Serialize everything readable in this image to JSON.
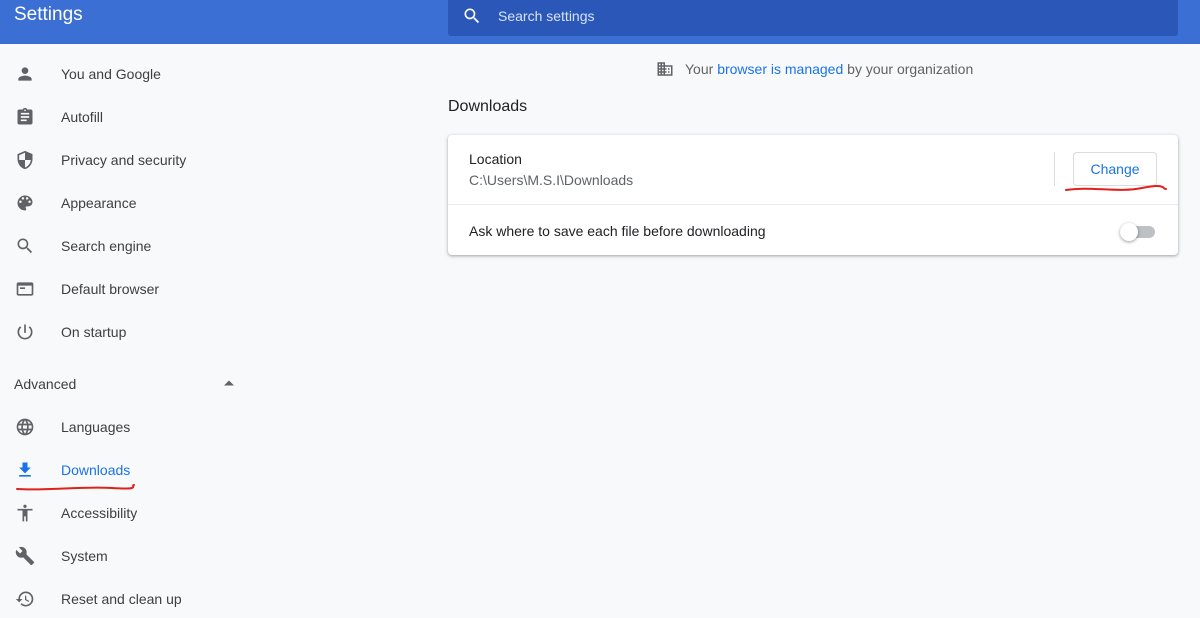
{
  "header": {
    "title": "Settings",
    "search": {
      "placeholder": "Search settings",
      "value": "",
      "icon": "search-icon"
    }
  },
  "sidebar": {
    "items": [
      {
        "label": "You and Google",
        "icon": "person-icon"
      },
      {
        "label": "Autofill",
        "icon": "clipboard-icon"
      },
      {
        "label": "Privacy and security",
        "icon": "shield-icon"
      },
      {
        "label": "Appearance",
        "icon": "palette-icon"
      },
      {
        "label": "Search engine",
        "icon": "search-icon"
      },
      {
        "label": "Default browser",
        "icon": "browser-icon"
      },
      {
        "label": "On startup",
        "icon": "power-icon"
      }
    ],
    "advanced": {
      "label": "Advanced",
      "expanded": true,
      "items": [
        {
          "label": "Languages",
          "icon": "globe-icon"
        },
        {
          "label": "Downloads",
          "icon": "download-icon",
          "active": true
        },
        {
          "label": "Accessibility",
          "icon": "accessibility-icon"
        },
        {
          "label": "System",
          "icon": "wrench-icon"
        },
        {
          "label": "Reset and clean up",
          "icon": "history-icon"
        }
      ]
    }
  },
  "notice": {
    "icon": "building-icon",
    "prefix": "Your ",
    "link1": "browser",
    "middle": " is ",
    "link2": "managed",
    "suffix": " by your organization"
  },
  "downloads": {
    "title": "Downloads",
    "location_title": "Location",
    "location_path": "C:\\Users\\M.S.I\\Downloads",
    "change_label": "Change",
    "ask_label": "Ask where to save each file before downloading",
    "ask_enabled": false
  },
  "colors": {
    "header_bg": "#3b6fd4",
    "search_bg": "#2b58b8",
    "accent": "#1a73e8",
    "annotation": "#e0201b"
  }
}
